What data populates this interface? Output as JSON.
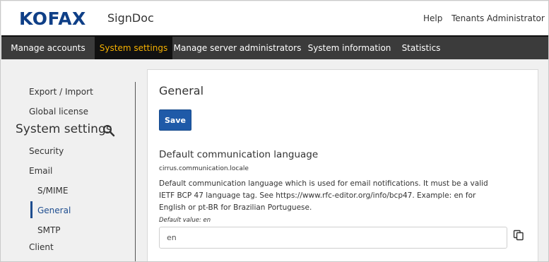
{
  "header": {
    "logo_text": "KOFAX",
    "product_name": "SignDoc",
    "help_label": "Help",
    "user_label": "Tenants Administrator",
    "user_icon": "chevron-down-icon"
  },
  "nav": {
    "items": [
      {
        "label": "Manage accounts"
      },
      {
        "label": "System settings"
      },
      {
        "label": "Manage server administrators"
      },
      {
        "label": "System information"
      },
      {
        "label": "Statistics"
      }
    ],
    "active_index": 1
  },
  "sidebar": {
    "heading": "System settings",
    "search_icon": "search-icon",
    "items": [
      {
        "label": "Export / Import"
      },
      {
        "label": "Global license"
      },
      {
        "label": "Security"
      },
      {
        "label": "Email"
      },
      {
        "label": "S/MIME"
      },
      {
        "label": "General"
      },
      {
        "label": "SMTP"
      },
      {
        "label": "Client"
      }
    ],
    "active_item": "General"
  },
  "main": {
    "title": "General",
    "save_label": "Save",
    "setting": {
      "title": "Default communication language",
      "key": "cirrus.communication.locale",
      "description": "Default communication language which is used for email notifications. It must be a valid IETF BCP 47 language tag. See https://www.rfc-editor.org/info/bcp47. Example: en for English or pt-BR for Brazilian Portuguese.",
      "default_value": "Default value: en",
      "value": "en",
      "copy_icon": "copy-icon"
    }
  },
  "colors": {
    "brand": "#0f3f87",
    "nav_bg": "#3b3b3b",
    "nav_active_text": "#f5b000",
    "primary_button": "#1f5aa8",
    "active_sidebar": "#1e4d8f"
  }
}
